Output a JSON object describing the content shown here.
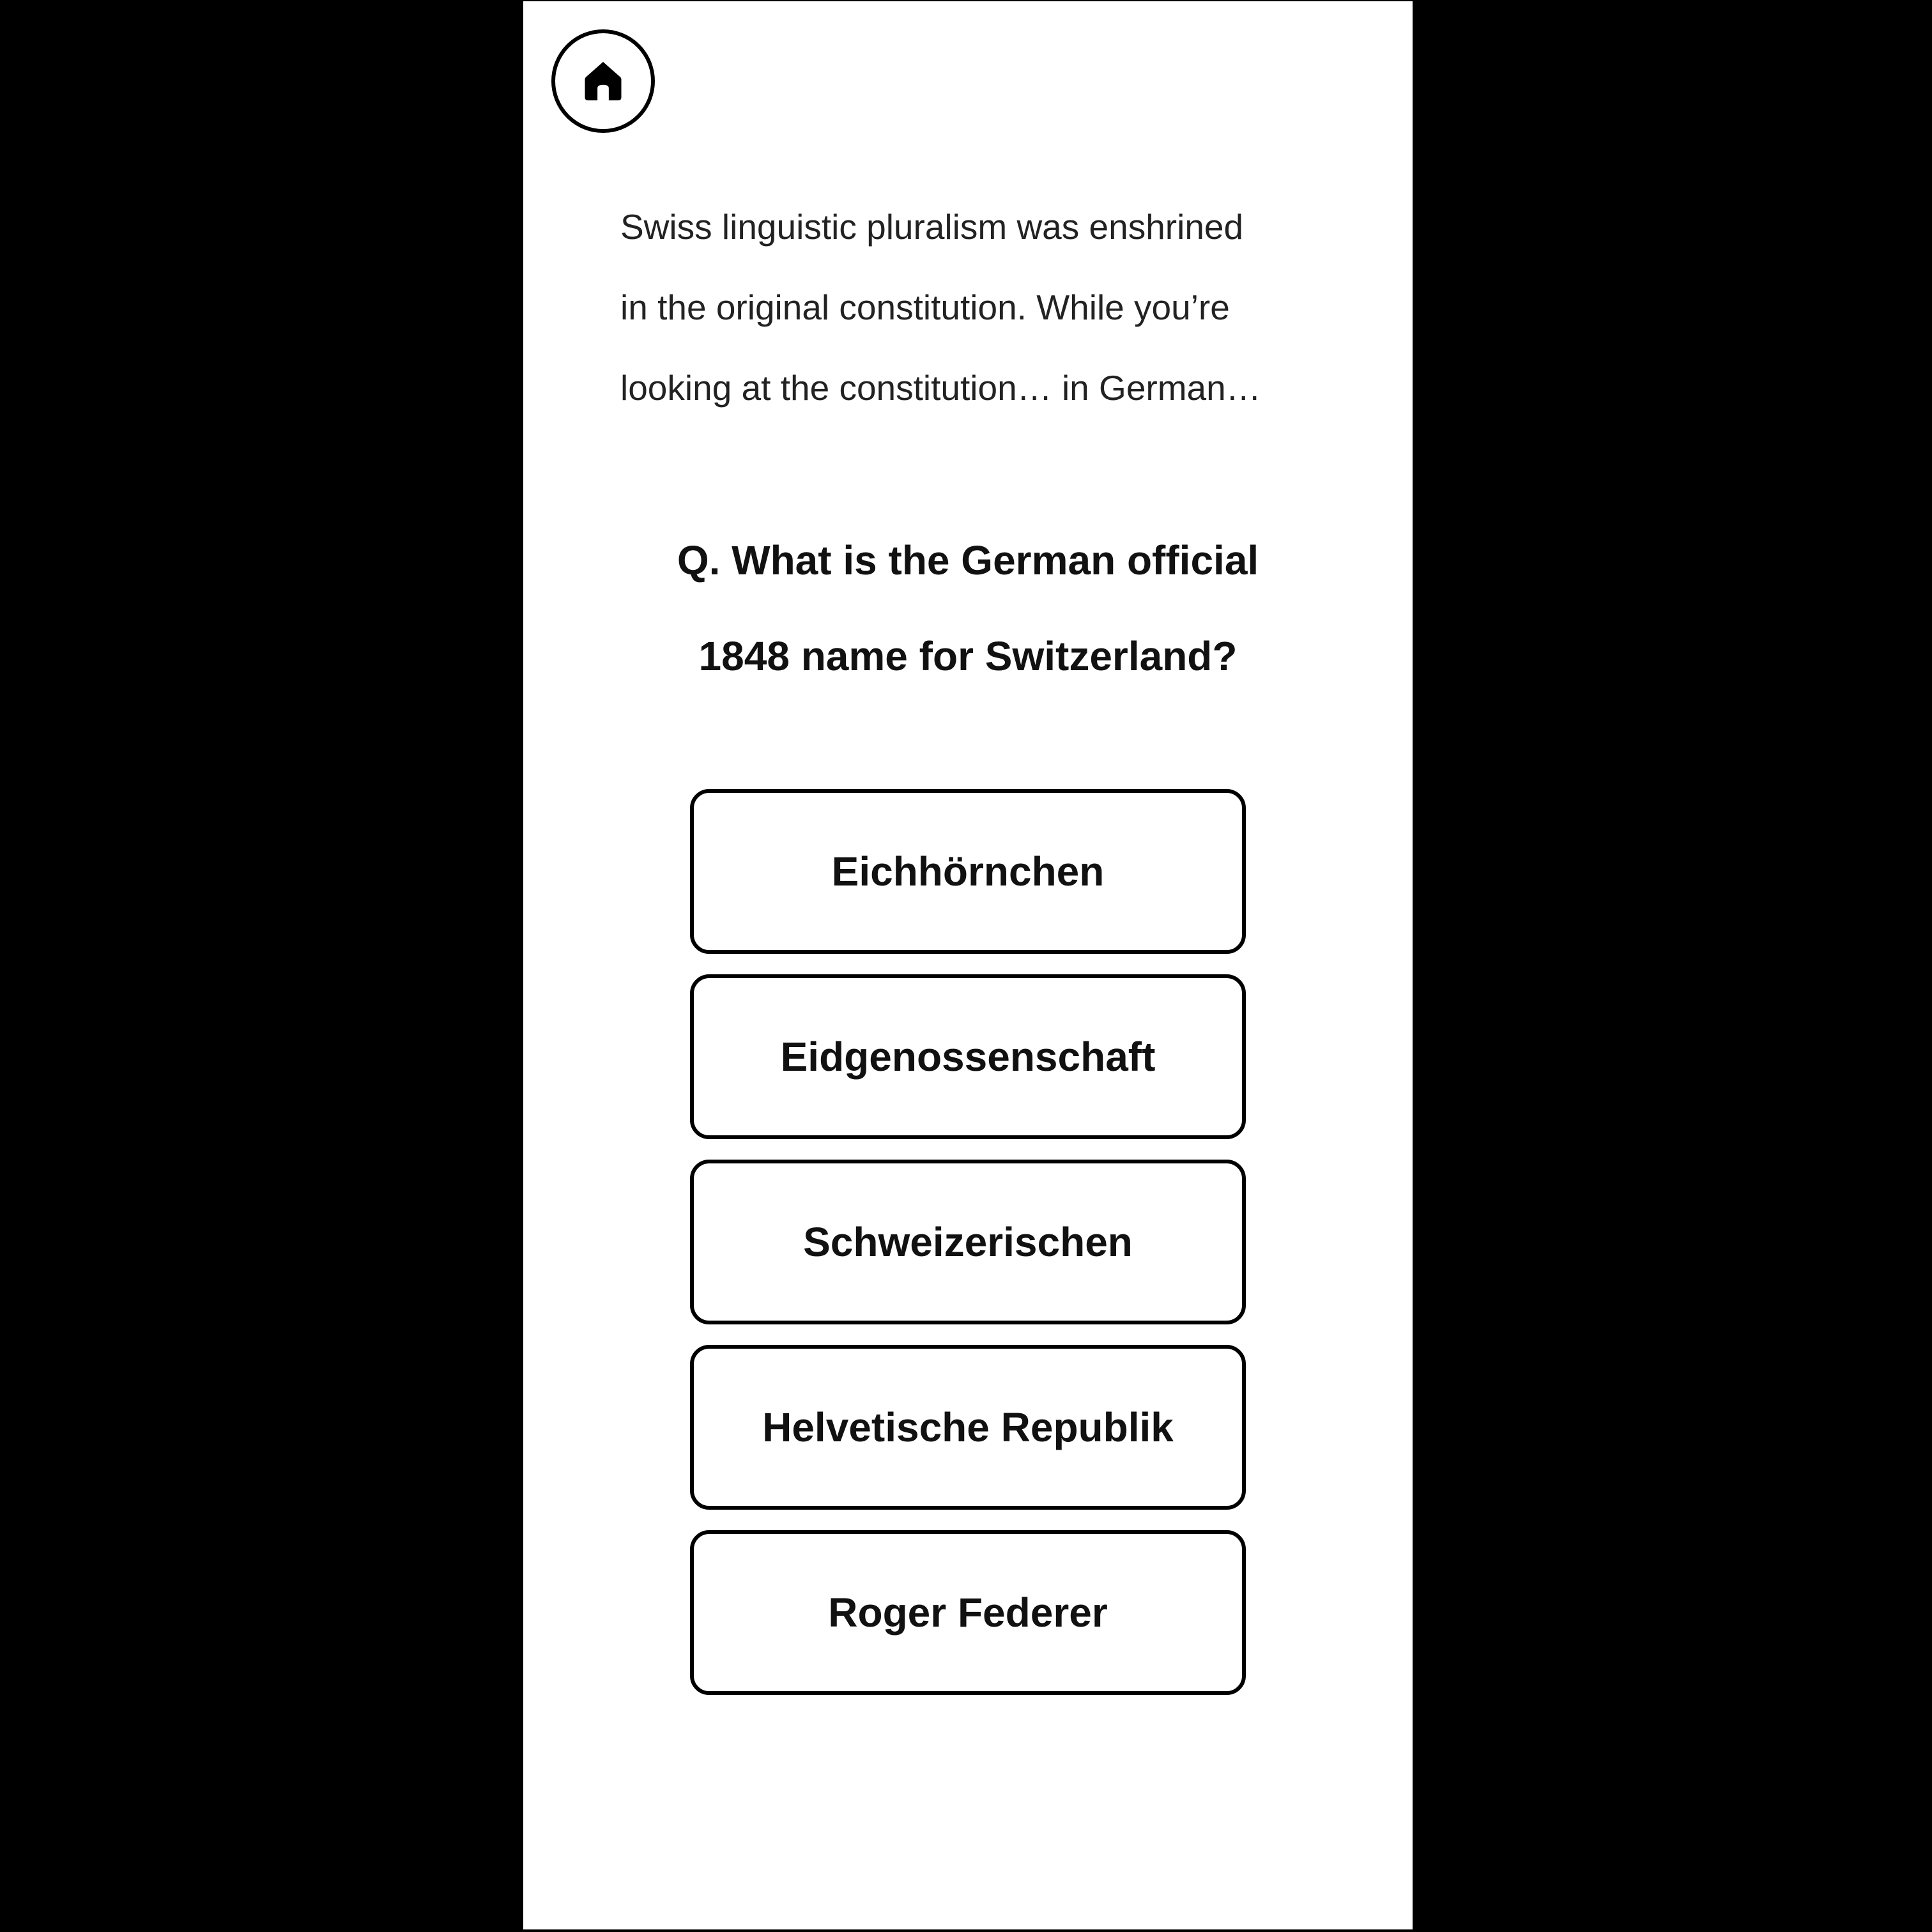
{
  "header": {
    "home_icon": "home-icon"
  },
  "intro": {
    "lines": [
      "Swiss linguistic pluralism was enshrined",
      "in the original constitution. While you’re",
      "looking at the constitution… in German…"
    ]
  },
  "question": {
    "lines": [
      "Q. What is the German official",
      "1848 name for Switzerland?"
    ]
  },
  "answers": [
    {
      "label": "Eichhörnchen"
    },
    {
      "label": "Eidgenossenschaft"
    },
    {
      "label": "Schweizerischen"
    },
    {
      "label": "Helvetische Republik"
    },
    {
      "label": "Roger Federer"
    }
  ]
}
